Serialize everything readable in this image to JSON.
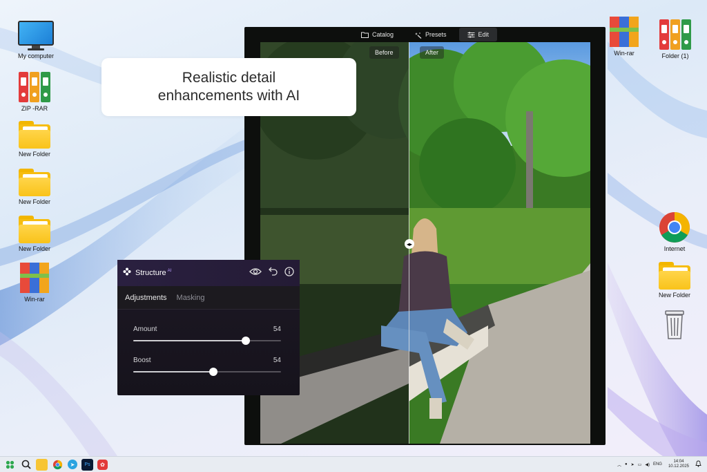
{
  "desktop": {
    "left_icons": [
      {
        "label": "My computer"
      },
      {
        "label": "ZIP -RAR"
      },
      {
        "label": "New Folder"
      },
      {
        "label": "New Folder"
      },
      {
        "label": "New Folder"
      },
      {
        "label": "Win-rar"
      }
    ],
    "right_icons": [
      {
        "label": "Win-rar"
      },
      {
        "label": "Folder (1)"
      },
      {
        "label": "Internet"
      },
      {
        "label": "New Folder"
      }
    ]
  },
  "caption": {
    "line1": "Realistic detail",
    "line2": "enhancements with AI"
  },
  "editor": {
    "tabs": [
      {
        "label": "Catalog",
        "icon": "folder-icon"
      },
      {
        "label": "Presets",
        "icon": "sparkle-icon"
      },
      {
        "label": "Edit",
        "icon": "sliders-icon",
        "active": true
      }
    ],
    "before_label": "Before",
    "after_label": "After"
  },
  "panel": {
    "title": "Structure",
    "badge": "AI",
    "tabs": [
      {
        "label": "Adjustments",
        "active": true
      },
      {
        "label": "Masking"
      }
    ],
    "sliders": [
      {
        "label": "Amount",
        "value": "54",
        "fraction": 0.76
      },
      {
        "label": "Boost",
        "value": "54",
        "fraction": 0.54
      }
    ]
  },
  "taskbar": {
    "lang": "ENG",
    "time": "14:04",
    "date": "10.12.2025"
  }
}
